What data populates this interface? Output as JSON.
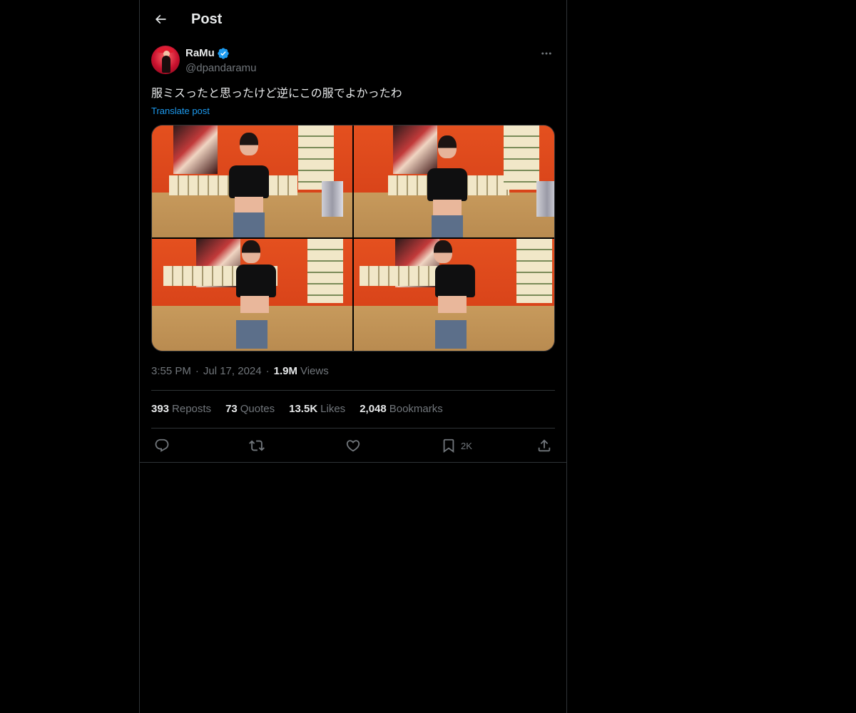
{
  "header": {
    "title": "Post",
    "back_icon": "arrow-left-icon"
  },
  "post": {
    "author": {
      "display_name": "RaMu",
      "handle": "@dpandaramu",
      "verified": true,
      "verified_color": "#1d9bf0"
    },
    "text": "服ミスったと思ったけど逆にこの服でよかったわ",
    "translate_label": "Translate post",
    "media": {
      "photo_count": 4
    },
    "time": "3:55 PM",
    "separator": "·",
    "date": "Jul 17, 2024",
    "views_count": "1.9M",
    "views_label": "Views",
    "stats": {
      "reposts": {
        "count": "393",
        "label": "Reposts"
      },
      "quotes": {
        "count": "73",
        "label": "Quotes"
      },
      "likes": {
        "count": "13.5K",
        "label": "Likes"
      },
      "bookmarks": {
        "count": "2,048",
        "label": "Bookmarks"
      }
    },
    "actions": {
      "reply_icon": "reply-icon",
      "repost_icon": "repost-icon",
      "like_icon": "heart-icon",
      "bookmark_icon": "bookmark-icon",
      "bookmark_count": "2K",
      "share_icon": "share-icon"
    }
  },
  "colors": {
    "background": "#000000",
    "text_primary": "#e7e9ea",
    "text_secondary": "#71767b",
    "link": "#1d9bf0",
    "border": "#2f3336"
  }
}
